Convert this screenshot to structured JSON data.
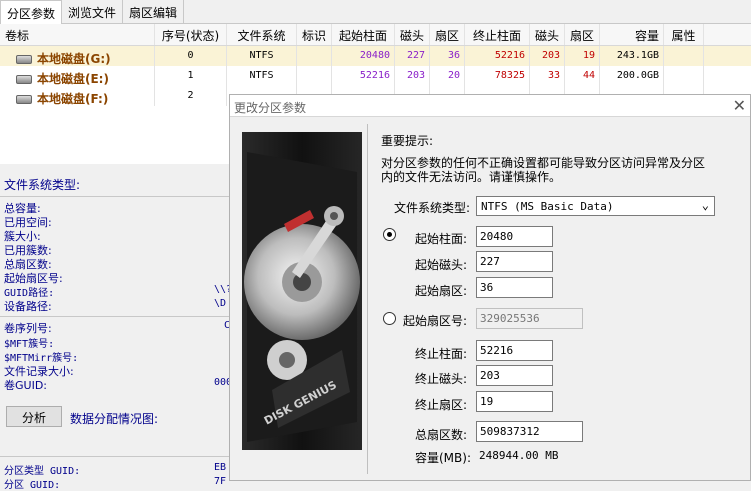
{
  "tabs": [
    "分区参数",
    "浏览文件",
    "扇区编辑"
  ],
  "table": {
    "headers": [
      "卷标",
      "序号(状态)",
      "文件系统",
      "标识",
      "起始柱面",
      "磁头",
      "扇区",
      "终止柱面",
      "磁头",
      "扇区",
      "容量",
      "属性"
    ],
    "rows": [
      {
        "name": "本地磁盘(G:)",
        "index": "0",
        "fs": "NTFS",
        "flag": "",
        "start_cyl": "20480",
        "start_head": "227",
        "start_sector": "36",
        "end_cyl": "52216",
        "end_head": "203",
        "end_sector": "19",
        "capacity": "243.1GB",
        "attr": ""
      },
      {
        "name": "本地磁盘(E:)",
        "index": "1",
        "fs": "NTFS",
        "flag": "",
        "start_cyl": "52216",
        "start_head": "203",
        "start_sector": "20",
        "end_cyl": "78325",
        "end_head": "33",
        "end_sector": "44",
        "capacity": "200.0GB",
        "attr": ""
      },
      {
        "name": "本地磁盘(F:)",
        "index": "2",
        "fs": "",
        "flag": "",
        "start_cyl": "",
        "start_head": "",
        "start_sector": "",
        "end_cyl": "",
        "end_head": "",
        "end_sector": "",
        "capacity": "",
        "attr": ""
      }
    ]
  },
  "left": {
    "fs_type_label": "文件系统类型:",
    "labels": [
      "总容量:",
      "已用空间:",
      "簇大小:",
      "已用簇数:",
      "总扇区数:",
      "起始扇区号:"
    ],
    "guid_path_label": "GUID路径:",
    "guid_path_value": "\\\\?",
    "device_path_label": "设备路径:",
    "device_path_value": "\\D",
    "volume_serial_label": "卷序列号:",
    "volume_serial_value": "C",
    "mft_label": "$MFT簇号:",
    "mftmirr_label": "$MFTMirr簇号:",
    "record_size_label": "文件记录大小:",
    "volume_guid_label": "卷GUID:",
    "volume_guid_value": "000",
    "analyze_button": "分析",
    "data_alloc_label": "数据分配情况图:",
    "partition_type_guid_label": "分区类型 GUID:",
    "partition_type_guid_value": "EB",
    "partition_guid_label": "分区 GUID:",
    "partition_guid_value": "7F"
  },
  "dialog": {
    "title": "更改分区参数",
    "close": "✕",
    "important_label": "重要提示:",
    "warning": [
      "对分区参数的任何不正确设置都可能导致分区访问异常及分区",
      "内的文件无法访问。请谨慎操作。"
    ],
    "fs_type_label": "文件系统类型:",
    "fs_type_value": "NTFS (MS Basic Data)",
    "start_cyl_label": "起始柱面:",
    "start_cyl_value": "20480",
    "start_head_label": "起始磁头:",
    "start_head_value": "227",
    "start_sector_label": "起始扇区:",
    "start_sector_value": "36",
    "start_lba_label": "起始扇区号:",
    "start_lba_value": "329025536",
    "end_cyl_label": "终止柱面:",
    "end_cyl_value": "52216",
    "end_head_label": "终止磁头:",
    "end_head_value": "203",
    "end_sector_label": "终止扇区:",
    "end_sector_value": "19",
    "total_sectors_label": "总扇区数:",
    "total_sectors_value": "509837312",
    "capacity_label": "容量(MB):",
    "capacity_value": "248944.00 MB",
    "brand_text": "DISK GENIUS"
  }
}
